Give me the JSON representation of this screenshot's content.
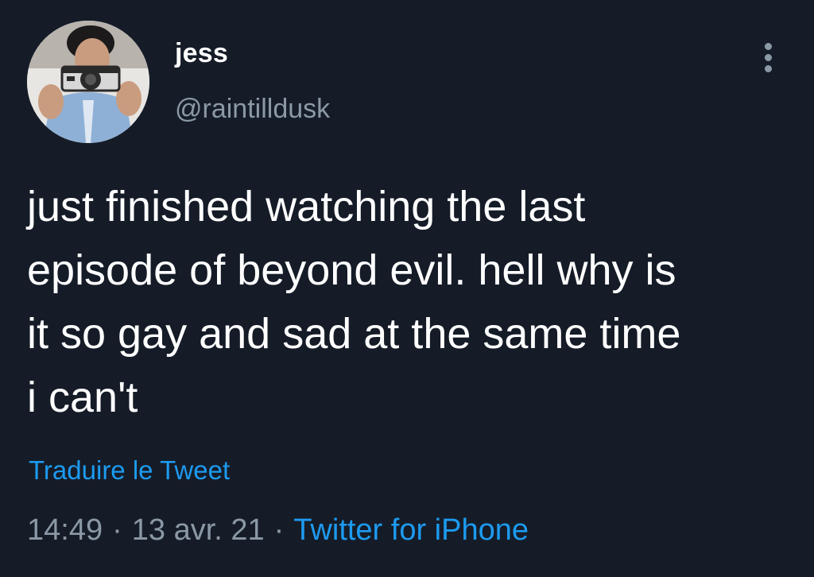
{
  "tweet": {
    "author": {
      "display_name": "jess",
      "handle": "@raintilldusk",
      "avatar_icon": "avatar-photo-icon"
    },
    "more_icon": "more-vertical-icon",
    "text": "just finished watching the last\nepisode of beyond evil. hell why is\nit so gay and sad at the same time\ni can't",
    "translate_label": "Traduire le Tweet",
    "meta": {
      "time": "14:49",
      "separator": "·",
      "date": "13 avr. 21",
      "source": "Twitter for iPhone"
    }
  },
  "colors": {
    "background": "#151c28",
    "text_primary": "#ffffff",
    "text_secondary": "#8b98a5",
    "accent": "#1d9bf0"
  }
}
